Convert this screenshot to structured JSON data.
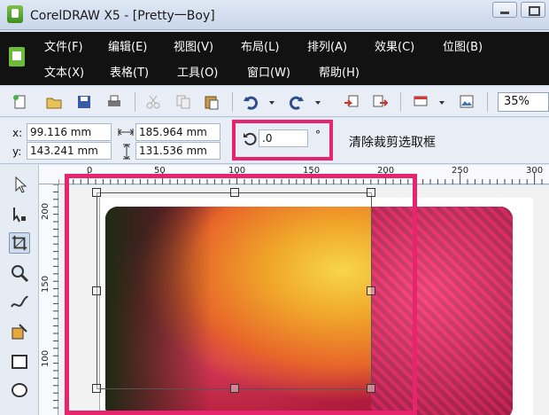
{
  "window": {
    "title": "CorelDRAW X5 - [Pretty一Boy]"
  },
  "menu": {
    "row1": [
      "文件(F)",
      "编辑(E)",
      "视图(V)",
      "布局(L)",
      "排列(A)",
      "效果(C)",
      "位图(B)"
    ],
    "row2": [
      "文本(X)",
      "表格(T)",
      "工具(O)",
      "窗口(W)",
      "帮助(H)"
    ]
  },
  "toolbar": {
    "zoom": "35%"
  },
  "property_bar": {
    "x_label": "x:",
    "x_value": "99.116 mm",
    "y_label": "y:",
    "y_value": "143.241 mm",
    "width_value": "185.964 mm",
    "height_value": "131.536 mm",
    "rotation_value": ".0",
    "degree_symbol": "°",
    "clear_crop_label": "清除裁剪选取框"
  },
  "ruler": {
    "h_labels": [
      "0",
      "50",
      "100",
      "150",
      "200",
      "250",
      "300"
    ],
    "v_labels": [
      "200",
      "150",
      "100"
    ]
  },
  "colors": {
    "highlight": "#e8246f",
    "menubar": "#121212"
  }
}
